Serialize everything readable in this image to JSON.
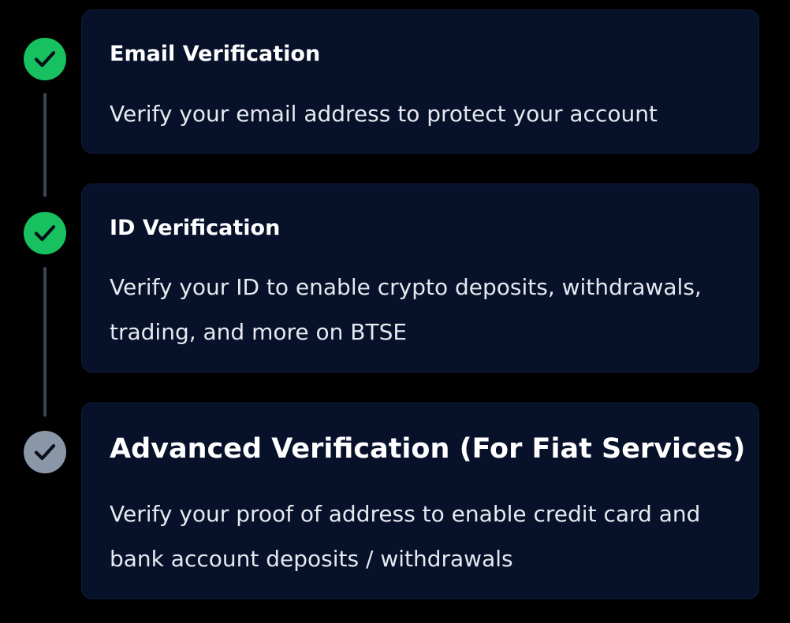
{
  "steps": [
    {
      "title": "Email Verification",
      "description": "Verify your email address to protect your account",
      "status": "completed",
      "icon": "check-icon"
    },
    {
      "title": "ID Verification",
      "description": "Verify your ID to enable crypto deposits, withdrawals, trading, and more on BTSE",
      "status": "completed",
      "icon": "check-icon"
    },
    {
      "title": "Advanced Verification (For Fiat Services)",
      "description": "Verify your proof of address to enable credit card and bank account deposits / withdrawals",
      "status": "pending",
      "icon": "check-icon"
    }
  ],
  "colors": {
    "background": "#000000",
    "card": "#07112a",
    "completed": "#17c15f",
    "pending": "#8a97a8",
    "connector": "#3a4656"
  }
}
